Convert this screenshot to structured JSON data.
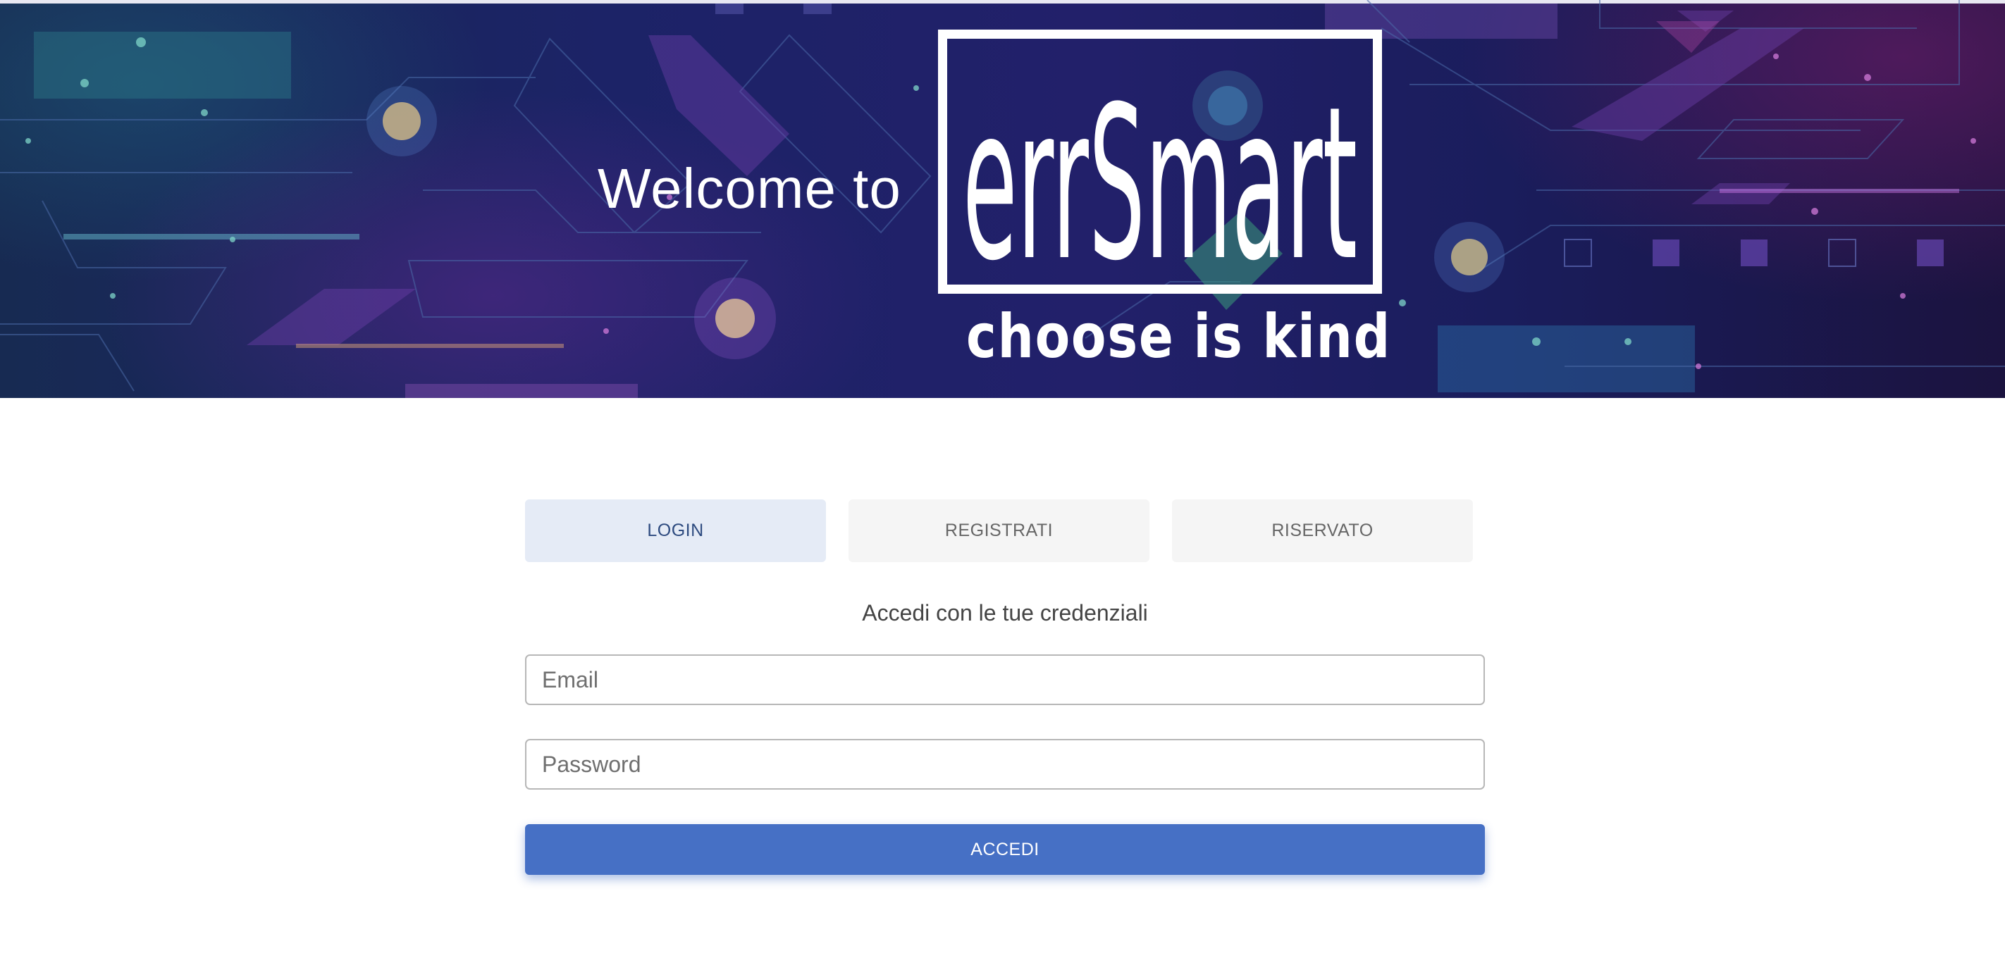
{
  "hero": {
    "welcome": "Welcome to",
    "logo_text": "errSmart",
    "tagline": "choose is kind"
  },
  "tabs": [
    {
      "label": "LOGIN",
      "active": true
    },
    {
      "label": "REGISTRATI",
      "active": false
    },
    {
      "label": "RISERVATO",
      "active": false
    }
  ],
  "form": {
    "subtitle": "Accedi con le tue credenziali",
    "email": {
      "placeholder": "Email",
      "value": ""
    },
    "password": {
      "placeholder": "Password",
      "value": ""
    },
    "submit_label": "ACCEDI"
  },
  "colors": {
    "accent": "#4670c5",
    "active_tab_bg": "#e5ebf6",
    "active_tab_text": "#2d4a7f",
    "tab_bg": "#f5f5f5"
  }
}
